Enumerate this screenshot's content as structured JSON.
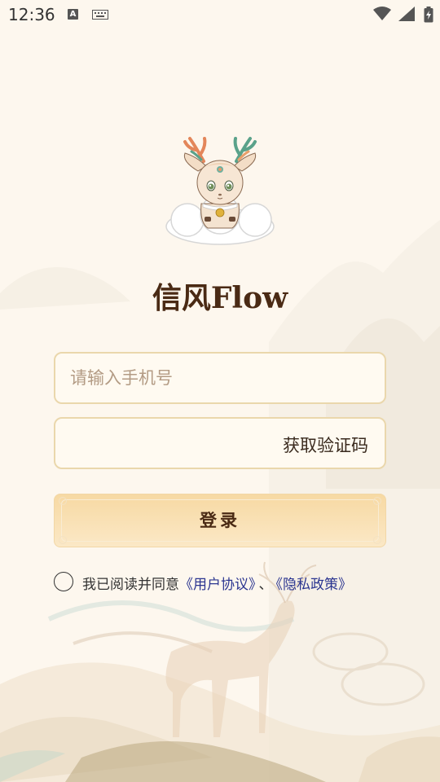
{
  "status_bar": {
    "time": "12:36",
    "a_badge": "A",
    "icons": [
      "text-input-icon",
      "keyboard-icon",
      "wifi-icon",
      "signal-icon",
      "battery-icon"
    ]
  },
  "app": {
    "title": "信风Flow"
  },
  "form": {
    "phone_placeholder": "请输入手机号",
    "code_placeholder": "",
    "get_code_label": "获取验证码",
    "login_label": "登录"
  },
  "agreement": {
    "checked": false,
    "prefix": "我已阅读并同意",
    "user_agreement": "《用户协议》",
    "separator": "、",
    "privacy_policy": "《隐私政策》"
  },
  "colors": {
    "background": "#fdf7ee",
    "title": "#4a2a14",
    "input_border": "#ead7ac",
    "button_top": "#f7d9a3",
    "button_bottom": "#fbe8c6",
    "link": "#2b3590"
  }
}
